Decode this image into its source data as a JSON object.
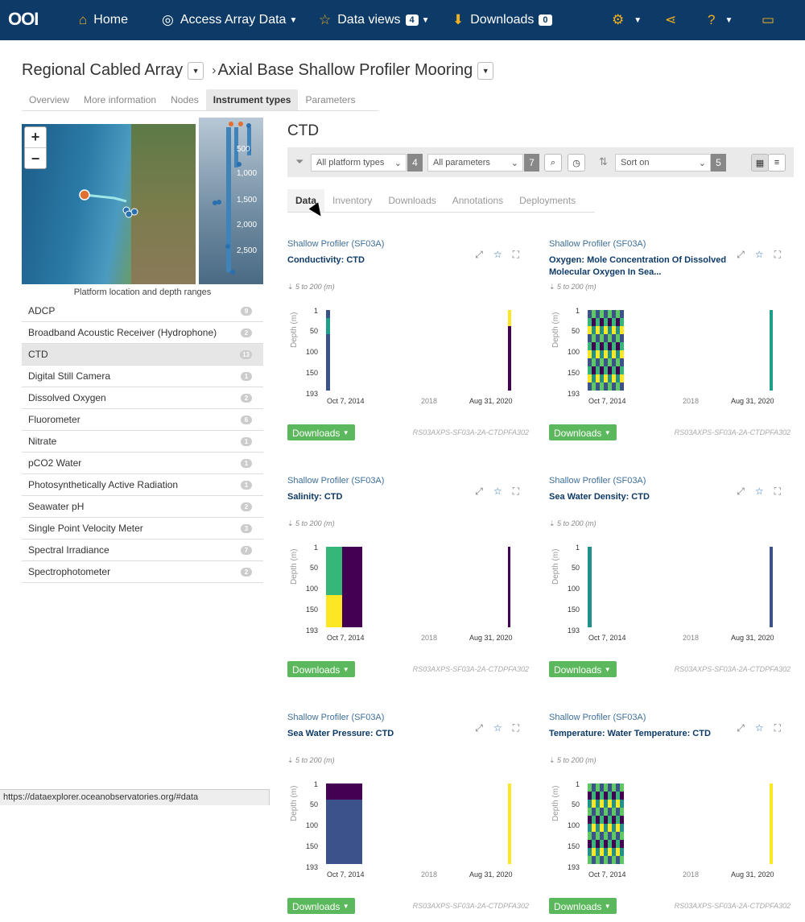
{
  "nav": {
    "brand": "OOI",
    "home": "Home",
    "access": "Access Array Data",
    "dataviews": "Data views",
    "dataviews_count": "4",
    "downloads": "Downloads",
    "downloads_count": "0"
  },
  "breadcrumb": {
    "array": "Regional Cabled Array",
    "site": "Axial Base Shallow Profiler Mooring"
  },
  "subtabs": [
    "Overview",
    "More information",
    "Nodes",
    "Instrument types",
    "Parameters"
  ],
  "subtab_active": "Instrument types",
  "map": {
    "zoom_in": "+",
    "zoom_out": "−",
    "caption": "Platform location and depth ranges",
    "depth_ticks": [
      "500",
      "1,000",
      "1,500",
      "2,000",
      "2,500"
    ]
  },
  "instrument_types": [
    {
      "name": "ADCP",
      "count": "9"
    },
    {
      "name": "Broadband Acoustic Receiver (Hydrophone)",
      "count": "2"
    },
    {
      "name": "CTD",
      "count": "13"
    },
    {
      "name": "Digital Still Camera",
      "count": "1"
    },
    {
      "name": "Dissolved Oxygen",
      "count": "2"
    },
    {
      "name": "Fluorometer",
      "count": "6"
    },
    {
      "name": "Nitrate",
      "count": "1"
    },
    {
      "name": "pCO2 Water",
      "count": "1"
    },
    {
      "name": "Photosynthetically Active Radiation",
      "count": "1"
    },
    {
      "name": "Seawater pH",
      "count": "2"
    },
    {
      "name": "Single Point Velocity Meter",
      "count": "3"
    },
    {
      "name": "Spectral Irradiance",
      "count": "7"
    },
    {
      "name": "Spectrophotometer",
      "count": "2"
    }
  ],
  "main": {
    "title": "CTD",
    "filters": {
      "platform_types": "All platform types",
      "platform_count": "4",
      "parameters": "All parameters",
      "parameters_count": "7",
      "sort_on": "Sort on",
      "sort_count": "5"
    },
    "tabs": [
      "Data",
      "Inventory",
      "Downloads",
      "Annotations",
      "Deployments"
    ],
    "tab_active": "Data"
  },
  "cards": [
    {
      "platform": "Shallow Profiler (SF03A)",
      "title": "Conductivity: CTD",
      "depth": "5 to 200 (m)",
      "ylabel": "Depth (m)",
      "yticks": [
        "1",
        "50",
        "100",
        "150",
        "193"
      ],
      "x_start": "Oct 7, 2014",
      "x_mid": "2018",
      "x_end": "Aug 31, 2020",
      "download": "Downloads",
      "ref": "RS03AXPS-SF03A-2A-CTDPFA302"
    },
    {
      "platform": "Shallow Profiler (SF03A)",
      "title": "Oxygen: Mole Concentration Of Dissolved Molecular Oxygen In Sea...",
      "depth": "5 to 200 (m)",
      "ylabel": "Depth (m)",
      "yticks": [
        "1",
        "50",
        "100",
        "150",
        "193"
      ],
      "x_start": "Oct 7, 2014",
      "x_mid": "2018",
      "x_end": "Aug 31, 2020",
      "download": "Downloads",
      "ref": "RS03AXPS-SF03A-2A-CTDPFA302"
    },
    {
      "platform": "Shallow Profiler (SF03A)",
      "title": "Salinity: CTD",
      "depth": "5 to 200 (m)",
      "ylabel": "Depth (m)",
      "yticks": [
        "1",
        "50",
        "100",
        "150",
        "193"
      ],
      "x_start": "Oct 7, 2014",
      "x_mid": "2018",
      "x_end": "Aug 31, 2020",
      "download": "Downloads",
      "ref": "RS03AXPS-SF03A-2A-CTDPFA302"
    },
    {
      "platform": "Shallow Profiler (SF03A)",
      "title": "Sea Water Density: CTD",
      "depth": "5 to 200 (m)",
      "ylabel": "Depth (m)",
      "yticks": [
        "1",
        "50",
        "100",
        "150",
        "193"
      ],
      "x_start": "Oct 7, 2014",
      "x_mid": "2018",
      "x_end": "Aug 31, 2020",
      "download": "Downloads",
      "ref": "RS03AXPS-SF03A-2A-CTDPFA302"
    },
    {
      "platform": "Shallow Profiler (SF03A)",
      "title": "Sea Water Pressure: CTD",
      "depth": "5 to 200 (m)",
      "ylabel": "Depth (m)",
      "yticks": [
        "1",
        "50",
        "100",
        "150",
        "193"
      ],
      "x_start": "Oct 7, 2014",
      "x_mid": "2018",
      "x_end": "Aug 31, 2020",
      "download": "Downloads",
      "ref": "RS03AXPS-SF03A-2A-CTDPFA302"
    },
    {
      "platform": "Shallow Profiler (SF03A)",
      "title": "Temperature: Water Temperature: CTD",
      "depth": "5 to 200 (m)",
      "ylabel": "Depth (m)",
      "yticks": [
        "1",
        "50",
        "100",
        "150",
        "193"
      ],
      "x_start": "Oct 7, 2014",
      "x_mid": "2018",
      "x_end": "Aug 31, 2020",
      "download": "Downloads",
      "ref": "RS03AXPS-SF03A-2A-CTDPFA302"
    }
  ],
  "status_url": "https://dataexplorer.oceanobservatories.org/#data",
  "colors": {
    "nav": "#0d3a66",
    "accent": "#f0b020",
    "download_green": "#5cb85c",
    "viridis_dark": "#440154",
    "viridis_teal": "#21918c",
    "viridis_yellow": "#fde725"
  }
}
